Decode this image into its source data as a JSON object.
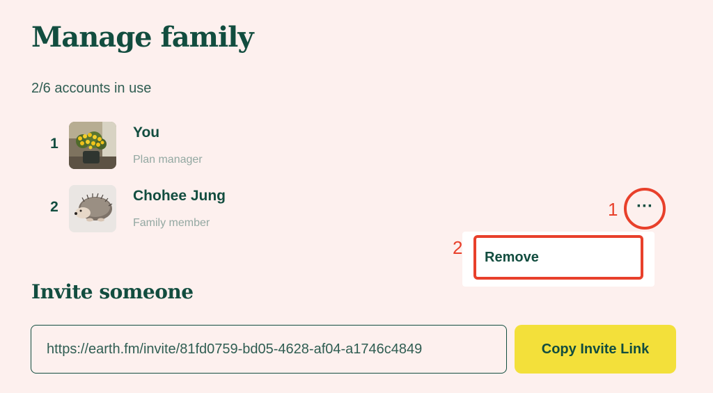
{
  "page": {
    "title": "Manage family",
    "usage": "2/6 accounts in use"
  },
  "members": [
    {
      "index": "1",
      "name": "You",
      "role": "Plan manager",
      "avatar": "potted-yellow-flowers"
    },
    {
      "index": "2",
      "name": "Chohee Jung",
      "role": "Family member",
      "avatar": "hedgehog"
    }
  ],
  "more_button": {
    "label": "···",
    "icon": "more-horizontal-icon"
  },
  "annotations": {
    "step1": "1",
    "step2": "2"
  },
  "context_menu": {
    "remove_label": "Remove"
  },
  "invite": {
    "title": "Invite someone",
    "link": "https://earth.fm/invite/81fd0759-bd05-4628-af04-a1746c4849",
    "copy_label": "Copy Invite Link"
  },
  "colors": {
    "background": "#fdf0ee",
    "primary_text": "#124d3f",
    "annotation": "#e8402b",
    "button": "#f3e03a"
  }
}
